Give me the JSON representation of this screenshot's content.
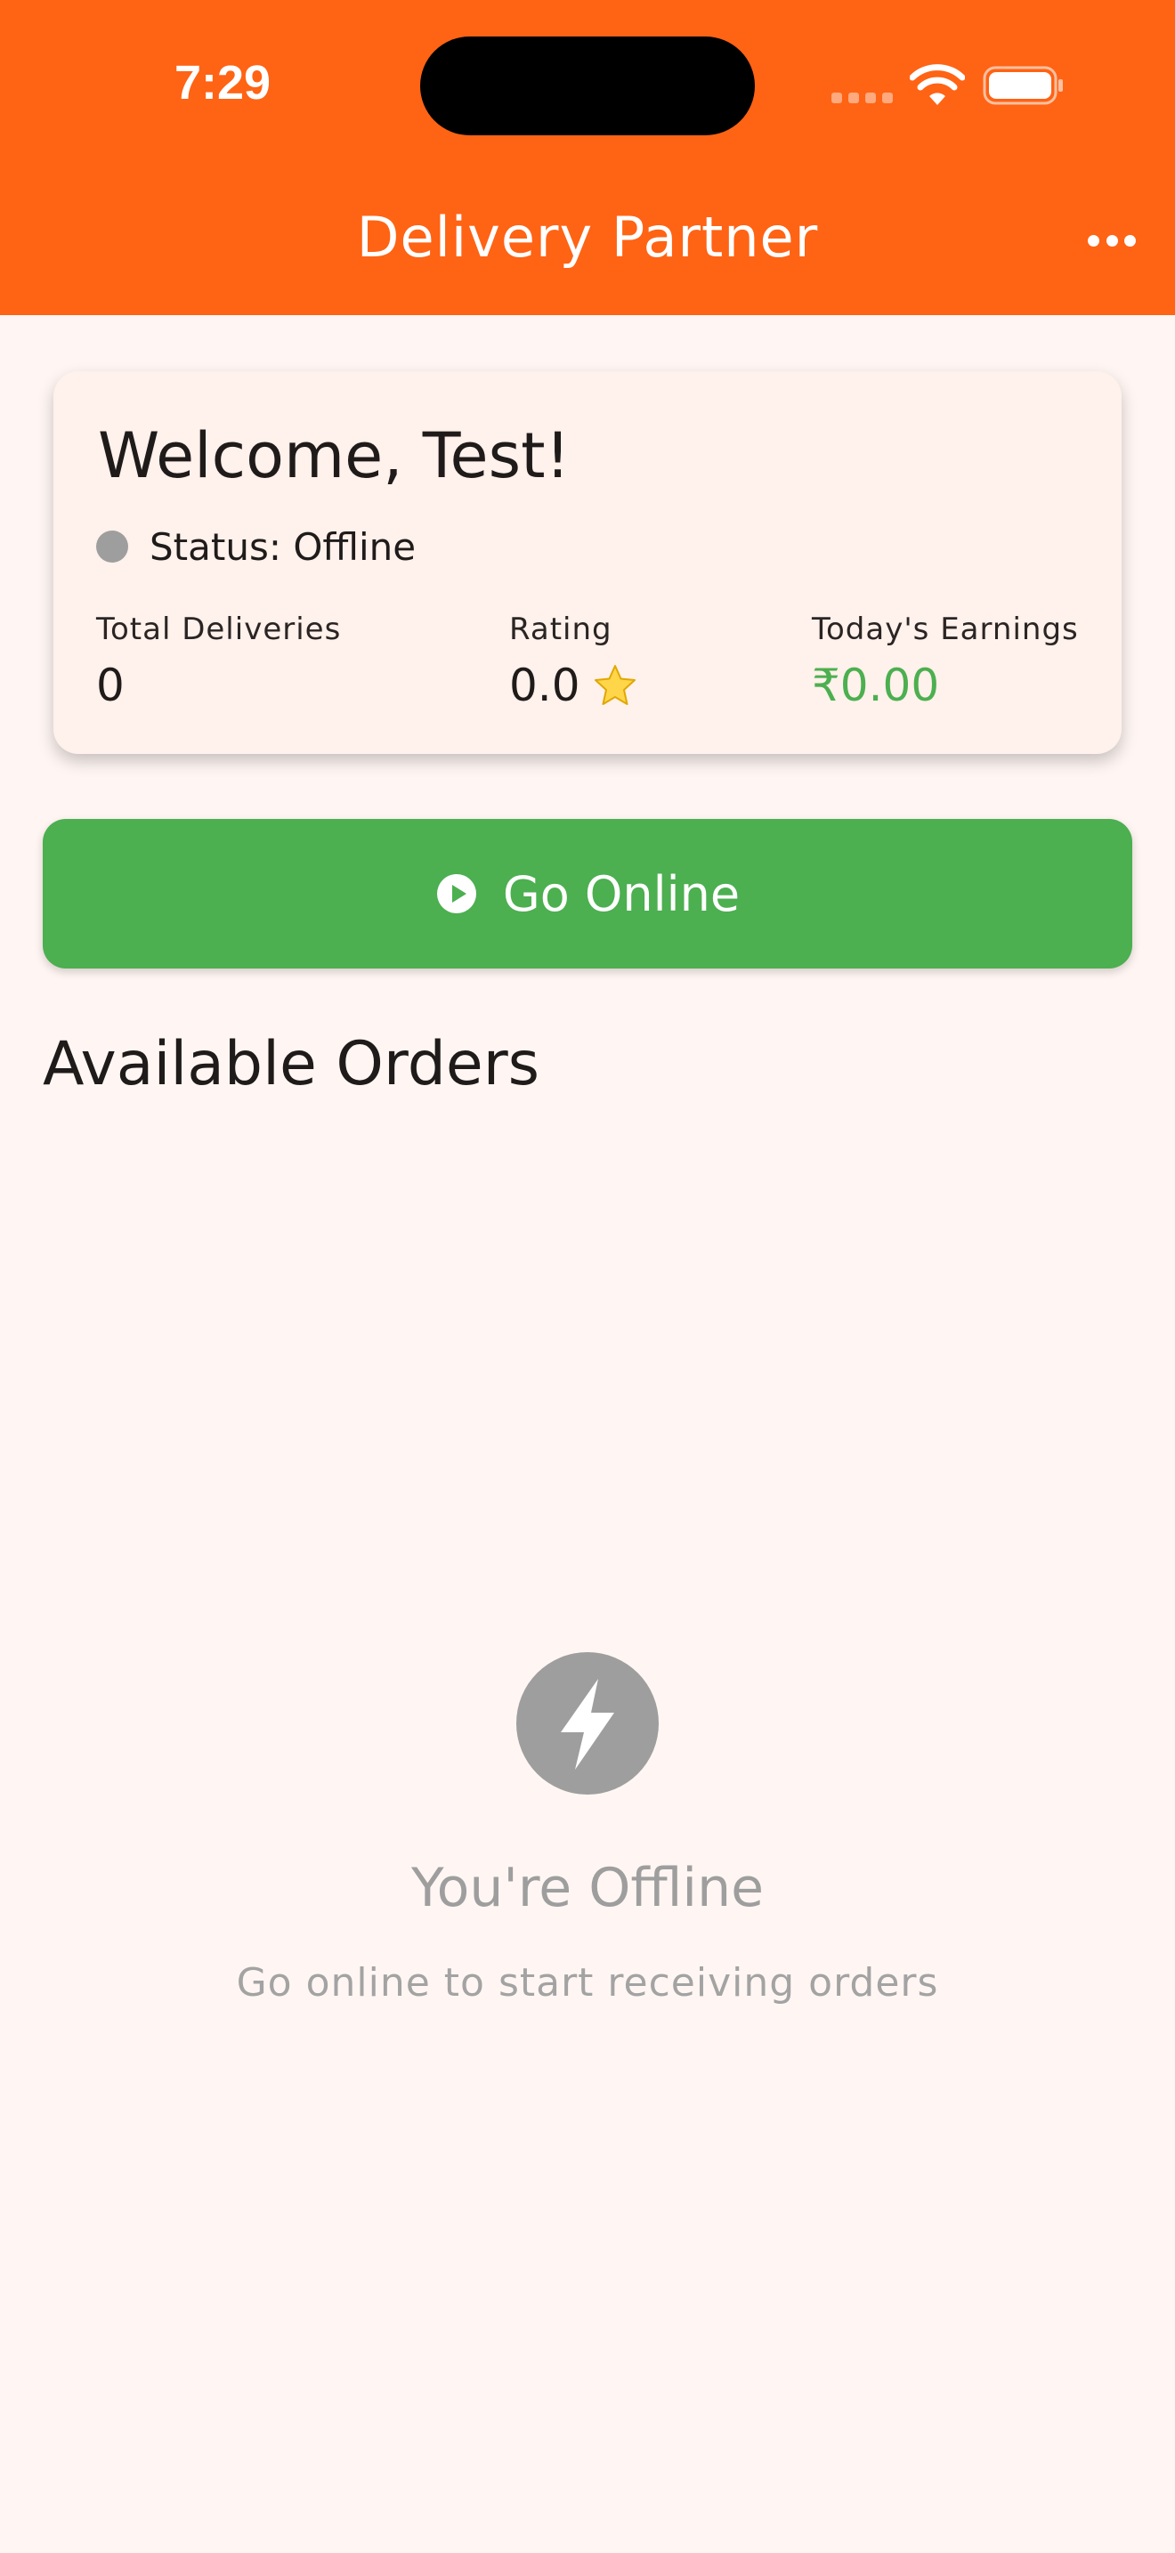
{
  "status_bar": {
    "time": "7:29",
    "signal_icon": "cellular-signal-icon",
    "wifi_icon": "wifi-icon",
    "battery_icon": "battery-icon"
  },
  "header": {
    "title": "Delivery Partner",
    "menu_icon": "more-horizontal-icon",
    "color": "#ff6314"
  },
  "welcome_card": {
    "greeting": "Welcome, Test!",
    "status_text": "Status: Offline",
    "status_color": "#9e9e9e",
    "stats": {
      "total_deliveries": {
        "label": "Total Deliveries",
        "value": "0"
      },
      "rating": {
        "label": "Rating",
        "value": "0.0",
        "icon": "star-icon"
      },
      "earnings": {
        "label": "Today's Earnings",
        "value": "₹0.00",
        "color": "#4caf50"
      }
    }
  },
  "go_online_button": {
    "label": "Go Online",
    "icon": "play-circle-icon",
    "color": "#4caf50"
  },
  "orders_section": {
    "title": "Available Orders"
  },
  "empty_state": {
    "icon": "lightning-bolt-icon",
    "title": "You're Offline",
    "subtitle": "Go online to start receiving orders"
  }
}
